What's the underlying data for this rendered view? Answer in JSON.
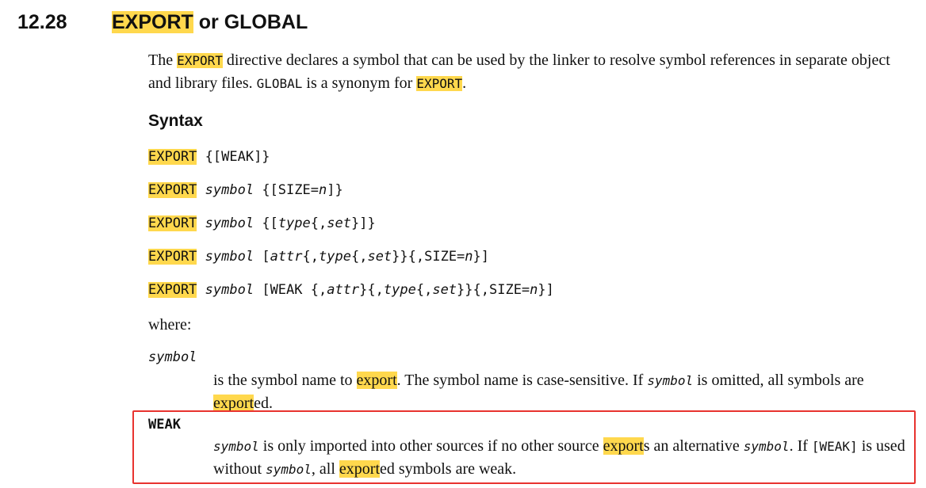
{
  "section": {
    "number": "12.28",
    "title_keyword": "EXPORT",
    "title_rest": " or GLOBAL"
  },
  "intro": {
    "p1": "The ",
    "kw1": "EXPORT",
    "p2": " directive declares a symbol that can be used by the linker to resolve symbol references in separate object and library files. ",
    "kw2": "GLOBAL",
    "p3": " is a synonym for ",
    "kw3": "EXPORT",
    "p4": "."
  },
  "syntax": {
    "heading": "Syntax",
    "keyword": "EXPORT",
    "symbol": "symbol",
    "line1_rest": " {[WEAK]}",
    "line2": {
      "a": " {[SIZE=",
      "n": "n",
      "b": "]}"
    },
    "line3": {
      "a": " {[",
      "type": "type",
      "b": "{,",
      "set": "set",
      "c": "}]}"
    },
    "line4": {
      "a": " [",
      "attr": "attr",
      "b": "{,",
      "type": "type",
      "c": "{,",
      "set": "set",
      "d": "}}{,SIZE=",
      "n": "n",
      "e": "}]"
    },
    "line5": {
      "a": " [WEAK {,",
      "attr": "attr",
      "b": "}{,",
      "type": "type",
      "c": "{,",
      "set": "set",
      "d": "}}{,SIZE=",
      "n": "n",
      "e": "}]"
    }
  },
  "where_label": "where:",
  "definitions": {
    "symbol_term": "symbol",
    "symbol_desc": {
      "a": "is the symbol name to ",
      "hl1": "export",
      "b": ". The symbol name is case-sensitive. If ",
      "code": "symbol",
      "c": " is omitted, all symbols are ",
      "hl2": "export",
      "d": "ed."
    },
    "weak_term": "WEAK",
    "weak_desc": {
      "code1": "symbol",
      "a": " is only imported into other sources if no other source ",
      "hl1": "export",
      "b": "s an alternative ",
      "code2": "symbol",
      "c": ". If ",
      "code3": "[WEAK]",
      "d": " is used without ",
      "code4": "symbol",
      "e": ", all ",
      "hl2": "export",
      "f": "ed symbols are weak."
    }
  },
  "colors": {
    "highlight": "#ffd84d",
    "annotation_box": "#e8332f"
  }
}
